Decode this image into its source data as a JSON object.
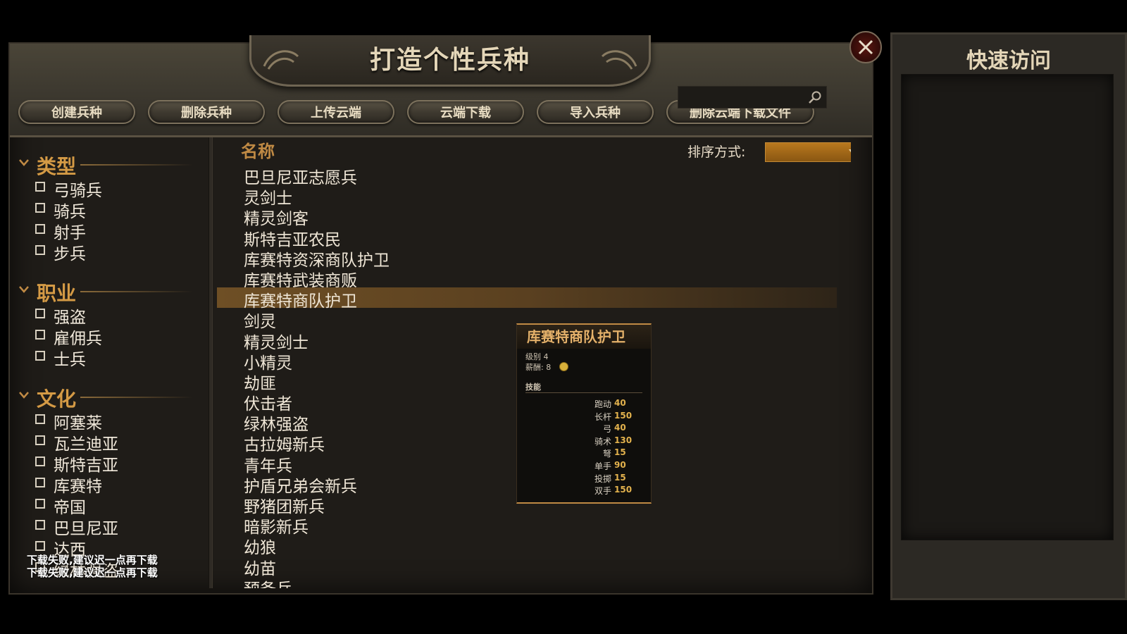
{
  "window": {
    "title": "打造个性兵种"
  },
  "toolbar": {
    "buttons": [
      "创建兵种",
      "删除兵种",
      "上传云端",
      "云端下载",
      "导入兵种",
      "删除云端下载文件"
    ],
    "search_placeholder": ""
  },
  "filters": {
    "groups": [
      {
        "title": "类型",
        "items": [
          "弓骑兵",
          "骑兵",
          "射手",
          "步兵"
        ]
      },
      {
        "title": "职业",
        "items": [
          "强盗",
          "雇佣兵",
          "士兵"
        ]
      },
      {
        "title": "文化",
        "items": [
          "阿塞莱",
          "瓦兰迪亚",
          "斯特吉亚",
          "库赛特",
          "帝国",
          "巴旦尼亚",
          "达西",
          "绿林强盗"
        ]
      }
    ]
  },
  "list": {
    "header_name": "名称",
    "sort_label": "排序方式:",
    "sort_value": "",
    "selected_index": 6,
    "units": [
      "巴旦尼亚志愿兵",
      "灵剑士",
      "精灵剑客",
      "斯特吉亚农民",
      "库赛特资深商队护卫",
      "库赛特武装商贩",
      "库赛特商队护卫",
      "剑灵",
      "精灵剑士",
      "小精灵",
      "劫匪",
      "伏击者",
      "绿林强盗",
      "古拉姆新兵",
      "青年兵",
      "护盾兄弟会新兵",
      "野猪团新兵",
      "暗影新兵",
      "幼狼",
      "幼苗",
      "预备兵"
    ]
  },
  "tooltip": {
    "title": "库赛特商队护卫",
    "level": "级别 4",
    "wage": "薪酬: 8",
    "skills_header": "技能",
    "skills": [
      {
        "name": "跑动",
        "value": "40"
      },
      {
        "name": "长杆",
        "value": "150"
      },
      {
        "name": "弓",
        "value": "40"
      },
      {
        "name": "骑术",
        "value": "130"
      },
      {
        "name": "弩",
        "value": "15"
      },
      {
        "name": "单手",
        "value": "90"
      },
      {
        "name": "投掷",
        "value": "15"
      },
      {
        "name": "双手",
        "value": "150"
      }
    ]
  },
  "notices": [
    "下载失败,建议迟一点再下载",
    "下载失败,建议迟一点再下载"
  ],
  "quick_access": {
    "title": "快速访问"
  },
  "colors": {
    "accent_orange": "#d49a45",
    "selected_row": "#6e4f25",
    "skill_value": "#e3b24d",
    "sort_select": "#b8781e"
  }
}
